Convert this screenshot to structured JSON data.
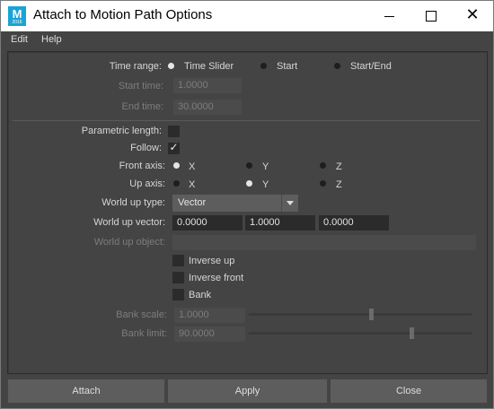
{
  "window": {
    "title": "Attach to Motion Path Options",
    "icon_letter": "M",
    "icon_subtext": "2016",
    "controls": {
      "minimize": "minimize-icon",
      "maximize": "maximize-icon",
      "close": "close-icon",
      "close_glyph": "✕"
    }
  },
  "menu": {
    "items": [
      "Edit",
      "Help"
    ]
  },
  "form": {
    "time_range": {
      "label": "Time range:",
      "options": [
        "Time Slider",
        "Start",
        "Start/End"
      ],
      "selected": "Time Slider"
    },
    "start_time": {
      "label": "Start time:",
      "value": "1.0000",
      "enabled": false
    },
    "end_time": {
      "label": "End time:",
      "value": "30.0000",
      "enabled": false
    },
    "parametric_length": {
      "label": "Parametric length:",
      "checked": false
    },
    "follow": {
      "label": "Follow:",
      "checked": true,
      "check_glyph": "✓"
    },
    "front_axis": {
      "label": "Front axis:",
      "options": [
        "X",
        "Y",
        "Z"
      ],
      "selected": "X"
    },
    "up_axis": {
      "label": "Up axis:",
      "options": [
        "X",
        "Y",
        "Z"
      ],
      "selected": "Y"
    },
    "world_up_type": {
      "label": "World up type:",
      "value": "Vector"
    },
    "world_up_vector": {
      "label": "World up vector:",
      "values": [
        "0.0000",
        "1.0000",
        "0.0000"
      ]
    },
    "world_up_object": {
      "label": "World up object:",
      "value": "",
      "enabled": false
    },
    "inverse_up": {
      "label": "Inverse up",
      "checked": false
    },
    "inverse_front": {
      "label": "Inverse front",
      "checked": false
    },
    "bank": {
      "label": "Bank",
      "checked": false
    },
    "bank_scale": {
      "label": "Bank scale:",
      "value": "1.0000",
      "slider_fraction": 0.55,
      "enabled": false
    },
    "bank_limit": {
      "label": "Bank limit:",
      "value": "90.0000",
      "slider_fraction": 0.73,
      "enabled": false
    }
  },
  "buttons": {
    "attach": "Attach",
    "apply": "Apply",
    "close": "Close"
  },
  "colors": {
    "background": "#444444",
    "field": "#2b2b2b",
    "button": "#5d5d5d",
    "icon_accent": "#1aa3d6"
  }
}
